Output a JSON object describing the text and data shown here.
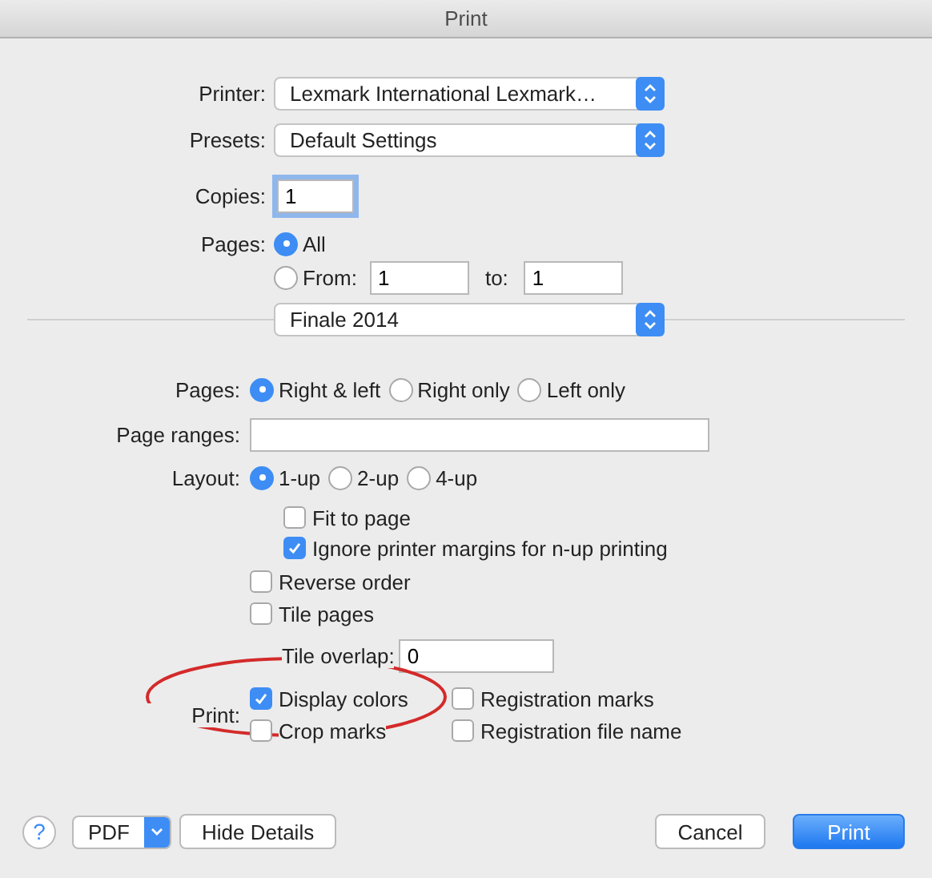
{
  "window": {
    "title": "Print"
  },
  "printer": {
    "label": "Printer:",
    "value": "Lexmark International Lexmark…"
  },
  "presets": {
    "label": "Presets:",
    "value": "Default Settings"
  },
  "copies": {
    "label": "Copies:",
    "value": "1"
  },
  "pages": {
    "label": "Pages:",
    "options": [
      {
        "label": "All",
        "selected": true
      },
      {
        "label": "From:",
        "selected": false
      }
    ],
    "from": "1",
    "to_label": "to:",
    "to": "1"
  },
  "section": {
    "value": "Finale 2014"
  },
  "page_sides": {
    "label": "Pages:",
    "options": [
      {
        "label": "Right & left",
        "selected": true
      },
      {
        "label": "Right only",
        "selected": false
      },
      {
        "label": "Left only",
        "selected": false
      }
    ]
  },
  "page_ranges": {
    "label": "Page ranges:"
  },
  "layout": {
    "label": "Layout:",
    "options": [
      {
        "label": "1-up",
        "selected": true
      },
      {
        "label": "2-up",
        "selected": false
      },
      {
        "label": "4-up",
        "selected": false
      }
    ]
  },
  "layout_checks": [
    {
      "label": "Fit to page",
      "checked": false
    },
    {
      "label": "Ignore printer margins for n-up printing",
      "checked": true
    }
  ],
  "page_checks": [
    {
      "label": "Reverse order",
      "checked": false
    },
    {
      "label": "Tile pages",
      "checked": false
    }
  ],
  "tile_overlap": {
    "label": "Tile overlap:",
    "value": "0"
  },
  "print": {
    "label": "Print:",
    "options": [
      {
        "label": "Display colors",
        "checked": true
      },
      {
        "label": "Registration marks",
        "checked": false
      },
      {
        "label": "Crop marks",
        "checked": false
      },
      {
        "label": "Registration file name",
        "checked": false
      }
    ]
  },
  "footer": {
    "help": "?",
    "pdf": "PDF",
    "details": "Hide Details",
    "cancel": "Cancel",
    "print": "Print"
  }
}
